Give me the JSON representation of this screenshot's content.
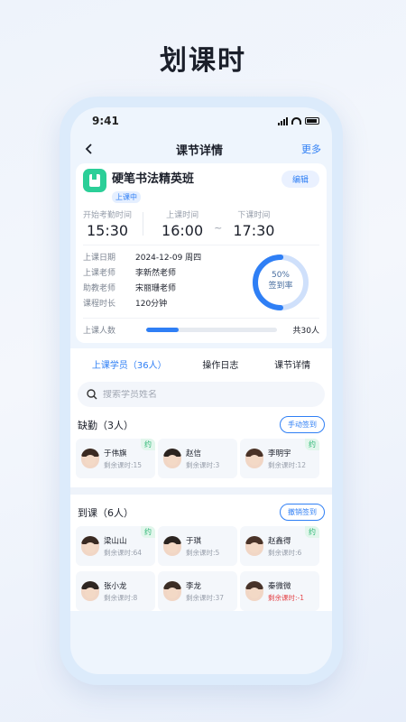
{
  "headline": "划课时",
  "status_bar": {
    "time": "9:41"
  },
  "nav": {
    "title": "课节详情",
    "more": "更多"
  },
  "class_info": {
    "name": "硬笔书法精英班",
    "status": "上课中",
    "edit_label": "编辑",
    "times": {
      "attendance_start_label": "开始考勤时间",
      "attendance_start": "15:30",
      "start_label": "上课时间",
      "start": "16:00",
      "separator": "~",
      "end_label": "下课时间",
      "end": "17:30"
    },
    "details": [
      {
        "key": "上课日期",
        "value": "2024-12-09 周四"
      },
      {
        "key": "上课老师",
        "value": "李新然老师"
      },
      {
        "key": "助教老师",
        "value": "宋丽珊老师"
      },
      {
        "key": "课程时长",
        "value": "120分钟"
      }
    ],
    "sign_rate": {
      "percent_text": "50%",
      "label": "签到率",
      "value": 0.5
    },
    "attendees": {
      "label": "上课人数",
      "total": "共30人",
      "fill": 0.25
    }
  },
  "tabs": [
    {
      "label": "上课学员（36人）",
      "active": true
    },
    {
      "label": "操作日志",
      "active": false
    },
    {
      "label": "课节详情",
      "active": false
    }
  ],
  "search": {
    "placeholder": "搜索学员姓名"
  },
  "absent": {
    "title": "缺勤（3人）",
    "action": "手动签到",
    "students": [
      {
        "name": "于伟旗",
        "remaining": "剩余课时:15",
        "reserved": "约"
      },
      {
        "name": "赵信",
        "remaining": "剩余课时:3",
        "reserved": ""
      },
      {
        "name": "李明宇",
        "remaining": "剩余课时:12",
        "reserved": "约"
      }
    ]
  },
  "present": {
    "title": "到课（6人）",
    "action": "撤销签到",
    "students": [
      {
        "name": "梁山山",
        "remaining": "剩余课时:64",
        "reserved": "约"
      },
      {
        "name": "于琪",
        "remaining": "剩余课时:5",
        "reserved": ""
      },
      {
        "name": "赵鑫得",
        "remaining": "剩余课时:6",
        "reserved": "约"
      },
      {
        "name": "张小龙",
        "remaining": "剩余课时:8",
        "reserved": ""
      },
      {
        "name": "李龙",
        "remaining": "剩余课时:37",
        "reserved": ""
      },
      {
        "name": "秦微微",
        "remaining": "剩余课时:-1",
        "reserved": ""
      }
    ]
  },
  "colors": {
    "accent": "#2f7ff5",
    "class_icon": "#2bcf98",
    "reserved": "#2bb673",
    "negative": "#e5484d"
  }
}
